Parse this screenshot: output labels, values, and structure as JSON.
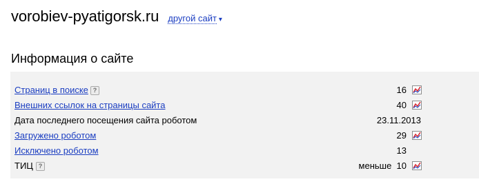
{
  "header": {
    "site_name": "vorobiev-pyatigorsk.ru",
    "other_site_label": "другой сайт",
    "other_site_arrow": "▾"
  },
  "section": {
    "title": "Информация о сайте"
  },
  "help_glyph": "?",
  "rows": [
    {
      "label": "Страниц в поиске",
      "value": "16",
      "is_link": true,
      "has_help": true,
      "has_chart_icon": true
    },
    {
      "label": "Внешних ссылок на страницы сайта",
      "value": "40",
      "is_link": true,
      "has_help": false,
      "has_chart_icon": true
    },
    {
      "label": "Дата последнего посещения сайта роботом",
      "value": "23.11.2013",
      "is_link": false,
      "has_help": false,
      "has_chart_icon": false
    },
    {
      "label": "Загружено роботом",
      "value": "29",
      "is_link": true,
      "has_help": false,
      "has_chart_icon": true
    },
    {
      "label": "Исключено роботом",
      "value": "13",
      "is_link": true,
      "has_help": false,
      "has_chart_icon": false
    },
    {
      "label": "ТИЦ",
      "value": "меньше  10",
      "is_link": false,
      "has_help": true,
      "has_chart_icon": true
    }
  ],
  "colors": {
    "link": "#1a3dc1",
    "panel_bg": "#f2f2f2",
    "chart_icon_red": "#d8262e",
    "chart_icon_blue": "#2a55c8"
  }
}
